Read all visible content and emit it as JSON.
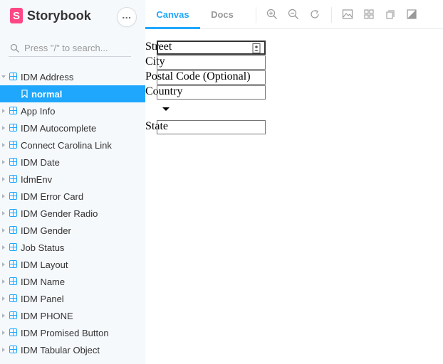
{
  "app": {
    "brand": "Storybook"
  },
  "search": {
    "placeholder": "Press \"/\" to search..."
  },
  "sidebar": {
    "items": [
      {
        "label": "IDM Address",
        "expanded": true
      },
      {
        "label": "normal",
        "selected": true
      },
      {
        "label": "App Info"
      },
      {
        "label": "IDM Autocomplete"
      },
      {
        "label": "Connect Carolina Link"
      },
      {
        "label": "IDM Date"
      },
      {
        "label": "IdmEnv"
      },
      {
        "label": "IDM Error Card"
      },
      {
        "label": "IDM Gender Radio"
      },
      {
        "label": "IDM Gender"
      },
      {
        "label": "Job Status"
      },
      {
        "label": "IDM Layout"
      },
      {
        "label": "IDM Name"
      },
      {
        "label": "IDM Panel"
      },
      {
        "label": "IDM PHONE"
      },
      {
        "label": "IDM Promised Button"
      },
      {
        "label": "IDM Tabular Object"
      }
    ]
  },
  "toolbar": {
    "tabs": [
      {
        "label": "Canvas",
        "active": true
      },
      {
        "label": "Docs"
      }
    ],
    "tools": [
      "zoom-in-icon",
      "zoom-out-icon",
      "reset-zoom-icon",
      "background-icon",
      "grid-icon",
      "viewport-icon",
      "contrast-icon"
    ]
  },
  "form": {
    "street": {
      "label": "Street",
      "value": ""
    },
    "city": {
      "label": "City",
      "value": ""
    },
    "postal": {
      "label": "Postal Code (Optional)",
      "value": ""
    },
    "country": {
      "label": "Country",
      "value": ""
    },
    "state": {
      "label": "State",
      "value": ""
    }
  },
  "colors": {
    "accent": "#1ea7fd",
    "brand": "#ff4785",
    "sidebar_bg": "#f6f9fc"
  }
}
